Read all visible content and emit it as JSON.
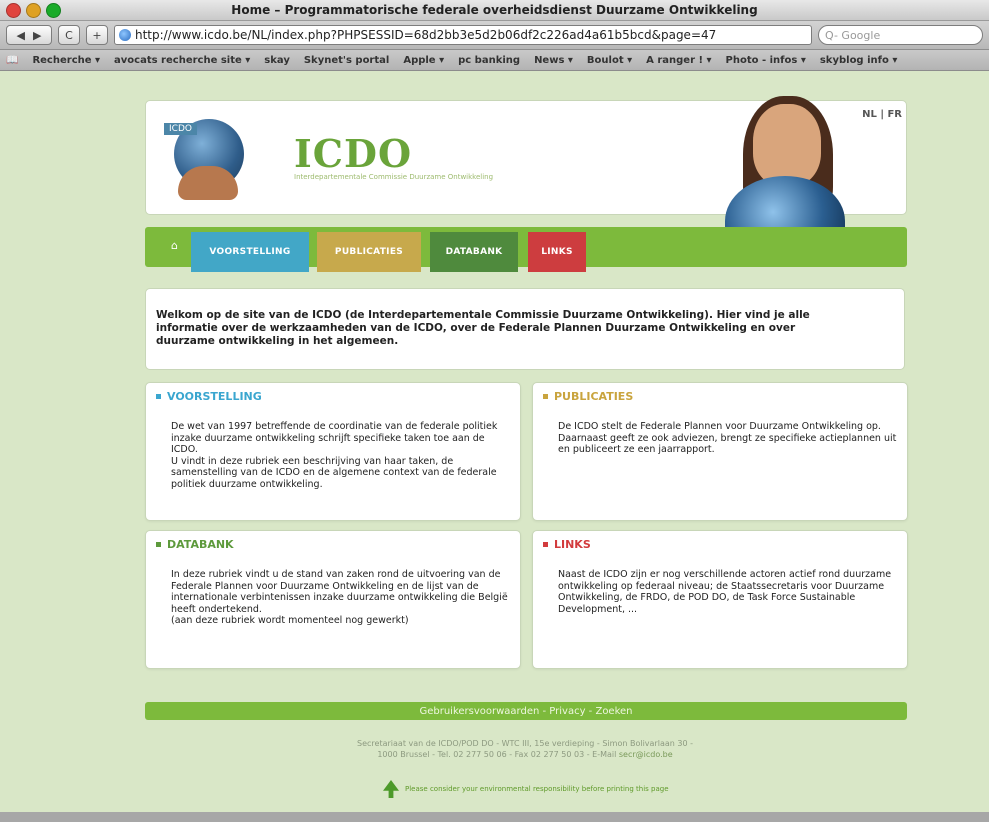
{
  "window": {
    "title": "Home – Programmatorische federale overheidsdienst Duurzame Ontwikkeling"
  },
  "toolbar": {
    "back": "◀",
    "forward": "▶",
    "reload": "C",
    "add": "+",
    "url": "http://www.icdo.be/NL/index.php?PHPSESSID=68d2bb3e5d2b06df2c226ad4a61b5bcd&page=47",
    "search_placeholder": "Q- Google"
  },
  "bookmarks": [
    "Recherche ▾",
    "avocats recherche site ▾",
    "skay",
    "Skynet's portal",
    "Apple ▾",
    "pc banking",
    "News ▾",
    "Boulot ▾",
    "A ranger ! ▾",
    "Photo - infos ▾",
    "skyblog info ▾"
  ],
  "header": {
    "logo_tag": "ICDO",
    "brand": "ICDO",
    "brand_sub": "Interdepartementale Commissie Duurzame Ontwikkeling",
    "lang_nl": "NL",
    "lang_sep": "|",
    "lang_fr": "FR"
  },
  "nav": {
    "home": "⌂",
    "items": [
      "VOORSTELLING",
      "PUBLICATIES",
      "DATABANK",
      "LINKS"
    ]
  },
  "welcome": {
    "text": "Welkom op de site van de ICDO (de Interdepartementale Commissie Duurzame Ontwikkeling). Hier vind je alle informatie over de werkzaamheden van de ICDO, over de Federale Plannen Duurzame Ontwikkeling en over duurzame ontwikkeling in het algemeen."
  },
  "cards": [
    {
      "title": "VOORSTELLING",
      "color": "#3aa6cf",
      "body": "De wet van 1997 betreffende de coordinatie van de federale politiek inzake duurzame ontwikkeling schrijft specifieke taken toe aan de ICDO.\nU vindt in deze rubriek een beschrijving van haar taken, de samenstelling van de ICDO en de algemene context van de federale politiek duurzame ontwikkeling."
    },
    {
      "title": "PUBLICATIES",
      "color": "#c9a43e",
      "body": "De ICDO stelt de Federale Plannen voor Duurzame Ontwikkeling op.\nDaarnaast geeft ze ook adviezen, brengt ze specifieke actieplannen uit en publiceert ze een jaarrapport."
    },
    {
      "title": "DATABANK",
      "color": "#5d9a3c",
      "body": "In deze rubriek vindt u de stand van zaken rond de uitvoering van de Federale Plannen voor Duurzame Ontwikkeling en de lijst van de internationale verbintenissen inzake duurzame ontwikkeling die België heeft ondertekend.\n(aan deze rubriek wordt momenteel nog gewerkt)"
    },
    {
      "title": "LINKS",
      "color": "#d23b3d",
      "body": "Naast de ICDO zijn er nog verschillende actoren actief rond duurzame ontwikkeling op federaal niveau; de Staatssecretaris voor Duurzame Ontwikkeling, de FRDO, de POD DO, de Task Force Sustainable Development, ..."
    }
  ],
  "footer": {
    "links": "Gebruikersvoorwaarden - Privacy - Zoeken",
    "address_1": "Secretariaat van de ICDO/POD DO - WTC III, 15e verdieping - Simon Bolivarlaan 30 -",
    "address_2": "1000 Brussel - Tel. 02 277 50 06 - Fax 02 277 50 03 - E-Mail",
    "email": "secr@icdo.be",
    "eco_note": "Please consider your environmental responsibility before printing this page"
  },
  "colors": {
    "page_bg": "#d9e7c7",
    "green_bar": "#7dba3c",
    "brand": "#6aa43a"
  }
}
